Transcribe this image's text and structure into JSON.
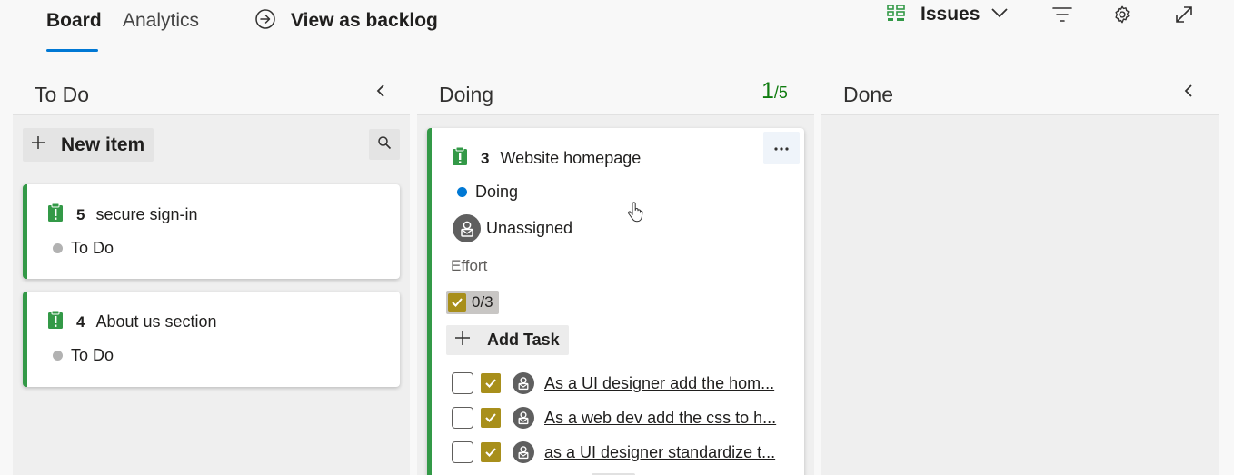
{
  "tabs": {
    "board": "Board",
    "analytics": "Analytics"
  },
  "view_backlog": {
    "label": "View as backlog",
    "icon": "circle-arrow-right-icon"
  },
  "backlog_level": {
    "label": "Issues",
    "icon": "backlog-level-icon"
  },
  "toolbar_icons": [
    "filter-icon",
    "gear-icon",
    "expand-icon"
  ],
  "accent_color": "#0078d4",
  "columns": [
    {
      "title": "To Do",
      "new_item_label": "New item",
      "cards": [
        {
          "id": "5",
          "title": "secure sign-in",
          "state": "To Do",
          "state_color": "#b2b2b2"
        },
        {
          "id": "4",
          "title": "About us section",
          "state": "To Do",
          "state_color": "#b2b2b2"
        }
      ]
    },
    {
      "title": "Doing",
      "wip_current": "1",
      "wip_limit": "/5",
      "cards": [
        {
          "id": "3",
          "title": "Website homepage",
          "state": "Doing",
          "state_color": "#0078d4",
          "assignee": "Unassigned",
          "effort_label": "Effort",
          "child_progress": "0/3",
          "add_task_label": "Add Task",
          "tasks": [
            {
              "title": "As a UI designer add the hom..."
            },
            {
              "title": "As a web dev add the css to h..."
            },
            {
              "title": "as a UI designer standardize t..."
            }
          ]
        }
      ]
    },
    {
      "title": "Done",
      "cards": []
    }
  ],
  "work_item_color": "#339947",
  "task_color": "#a88f1b"
}
